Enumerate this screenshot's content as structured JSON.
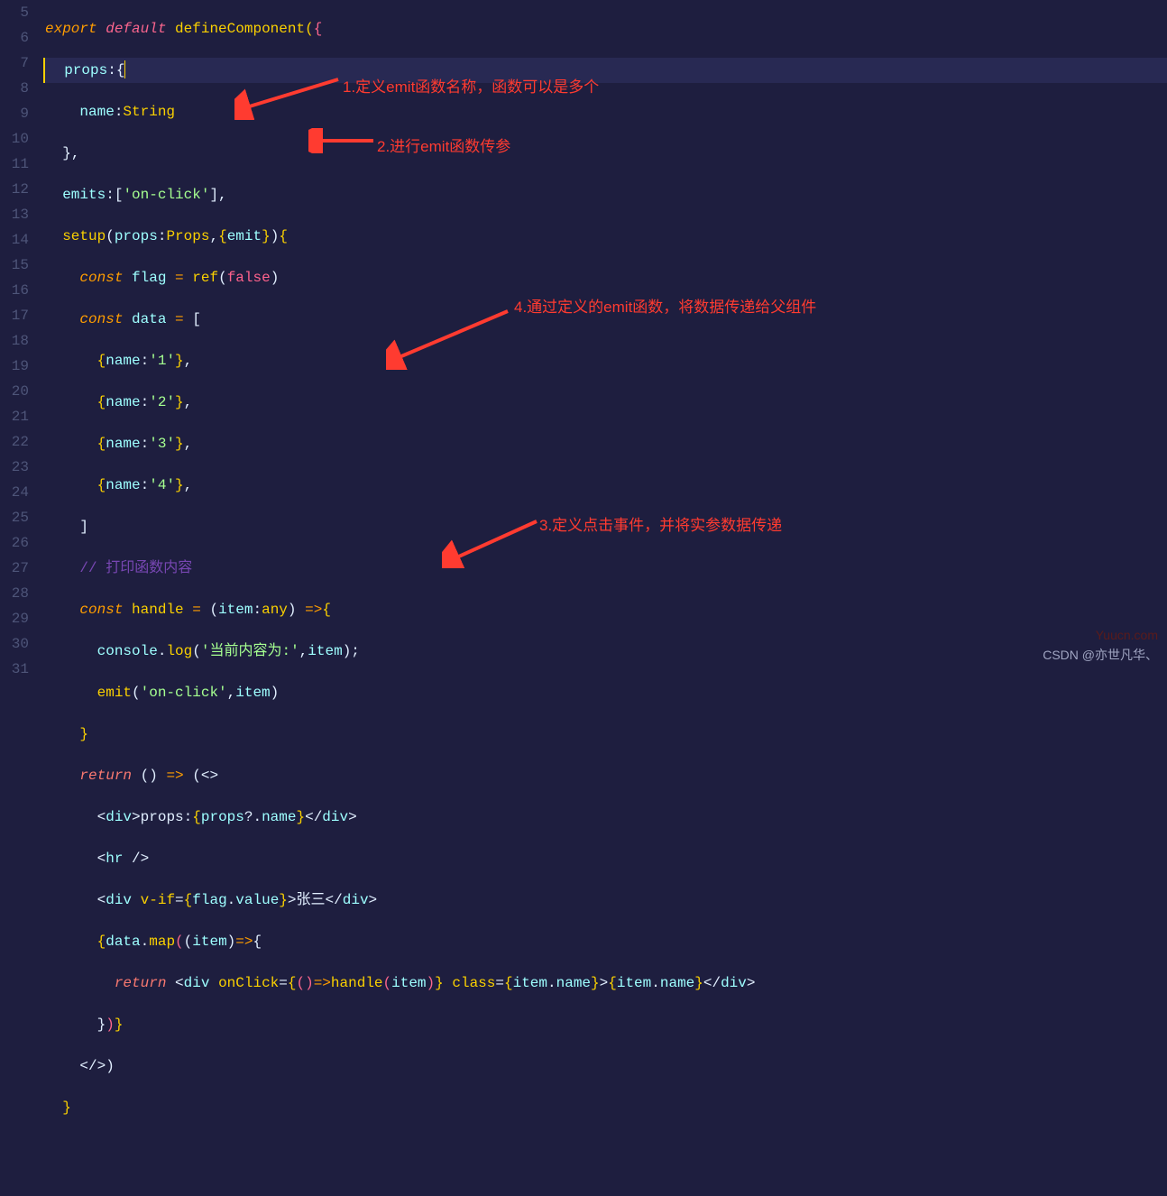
{
  "lineNumbers": [
    "5",
    "6",
    "7",
    "8",
    "9",
    "10",
    "11",
    "12",
    "13",
    "14",
    "15",
    "16",
    "17",
    "18",
    "19",
    "20",
    "21",
    "22",
    "23",
    "24",
    "25",
    "26",
    "27",
    "28",
    "29",
    "30",
    "31"
  ],
  "code": {
    "l5_export": "export",
    "l5_default": "default",
    "l5_fn": "defineComponent",
    "l6_props": "props",
    "l7_name": "name",
    "l7_type": "String",
    "l9_emits": "emits",
    "l9_str": "'on-click'",
    "l10_setup": "setup",
    "l10_props": "props",
    "l10_Props": "Props",
    "l10_emit": "emit",
    "l11_const": "const",
    "l11_flag": "flag",
    "l11_ref": "ref",
    "l11_false": "false",
    "l12_const": "const",
    "l12_data": "data",
    "l13_name": "name",
    "l13_v": "'1'",
    "l14_name": "name",
    "l14_v": "'2'",
    "l15_name": "name",
    "l15_v": "'3'",
    "l16_name": "name",
    "l16_v": "'4'",
    "l18_comment": "// 打印函数内容",
    "l19_const": "const",
    "l19_handle": "handle",
    "l19_item": "item",
    "l19_any": "any",
    "l20_console": "console",
    "l20_log": "log",
    "l20_str": "'当前内容为:'",
    "l20_item": "item",
    "l21_emit": "emit",
    "l21_str": "'on-click'",
    "l21_item": "item",
    "l23_return": "return",
    "l24_div": "div",
    "l24_text": "props:",
    "l24_props": "props",
    "l24_name": "name",
    "l25_hr": "hr",
    "l26_div": "div",
    "l26_vif": "v-if",
    "l26_flag": "flag",
    "l26_value": "value",
    "l26_text": "张三",
    "l27_data": "data",
    "l27_map": "map",
    "l27_item": "item",
    "l28_return": "return",
    "l28_div": "div",
    "l28_onClick": "onClick",
    "l28_handle": "handle",
    "l28_item": "item",
    "l28_class": "class",
    "l28_itemname1": "item",
    "l28_name1": "name",
    "l28_itemname2": "item",
    "l28_name2": "name"
  },
  "annotations": {
    "a1": "1.定义emit函数名称，函数可以是多个",
    "a2": "2.进行emit函数传参",
    "a3": "3.定义点击事件，并将实参数据传递",
    "a4": "4.通过定义的emit函数，将数据传递给父组件"
  },
  "watermark": {
    "site": "Yuucn.com",
    "csdn": "CSDN @亦世凡华、"
  }
}
